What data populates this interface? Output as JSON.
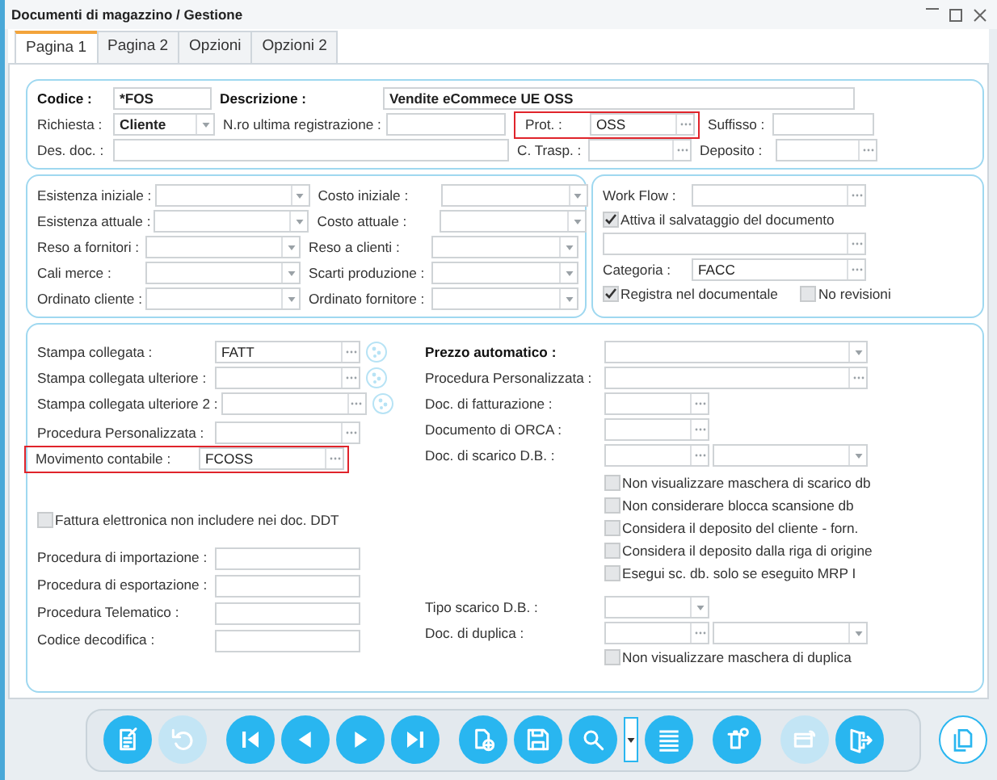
{
  "window": {
    "title": "Documenti di magazzino / Gestione"
  },
  "tabs": [
    {
      "label": "Pagina 1",
      "selected": true
    },
    {
      "label": "Pagina 2",
      "selected": false
    },
    {
      "label": "Opzioni",
      "selected": false
    },
    {
      "label": "Opzioni 2",
      "selected": false
    }
  ],
  "header": {
    "codice": {
      "label": "Codice :",
      "value": "*FOS",
      "label_bold": true,
      "value_bold": true
    },
    "descrizione": {
      "label": "Descrizione :",
      "value": "Vendite eCommece UE OSS",
      "label_bold": true,
      "value_bold": true
    },
    "richiesta": {
      "label": "Richiesta :",
      "value": "Cliente",
      "value_bold": true
    },
    "nro_ultima_registrazione": {
      "label": "N.ro ultima registrazione :"
    },
    "prot": {
      "label": "Prot. :",
      "value": "OSS",
      "highlighted": true
    },
    "suffisso": {
      "label": "Suffisso :"
    },
    "des_doc": {
      "label": "Des. doc. :"
    },
    "c_trasp": {
      "label": "C. Trasp. :"
    },
    "deposito": {
      "label": "Deposito :"
    }
  },
  "stock": [
    {
      "label": "Esistenza iniziale :"
    },
    {
      "label": "Costo iniziale :"
    },
    {
      "label": "Esistenza attuale :"
    },
    {
      "label": "Costo attuale :"
    },
    {
      "label": "Reso a fornitori :"
    },
    {
      "label": "Reso a clienti :"
    },
    {
      "label": "Cali merce :"
    },
    {
      "label": "Scarti produzione :"
    },
    {
      "label": "Ordinato cliente :"
    },
    {
      "label": "Ordinato fornitore :"
    }
  ],
  "workflow": {
    "work_flow": {
      "label": "Work Flow :"
    },
    "attiva": {
      "label": "Attiva il salvataggio del documento",
      "checked": true
    },
    "categoria": {
      "label": "Categoria :",
      "value": "FACC"
    },
    "registra": {
      "label": "Registra nel documentale",
      "checked": true
    },
    "no_revisioni": {
      "label": "No revisioni",
      "checked": false
    }
  },
  "print": {
    "stampa_collegata": {
      "label": "Stampa collegata :",
      "value": "FATT"
    },
    "stampa_ulteriore": {
      "label": "Stampa collegata ulteriore :"
    },
    "stampa_ulteriore_2": {
      "label": "Stampa collegata ulteriore 2 :"
    },
    "procedura_personalizzata": {
      "label": "Procedura Personalizzata :"
    },
    "movimento_contabile": {
      "label": "Movimento contabile :",
      "value": "FCOSS",
      "highlighted": true
    },
    "fattura_elettronica": {
      "label": "Fattura elettronica non includere nei doc. DDT",
      "checked": false
    },
    "procedura_importazione": {
      "label": "Procedura di importazione :"
    },
    "procedura_esportazione": {
      "label": "Procedura di esportazione :"
    },
    "procedura_telematico": {
      "label": "Procedura Telematico :"
    },
    "codice_decodifica": {
      "label": "Codice decodifica :"
    }
  },
  "options": {
    "prezzo_automatico": {
      "label": "Prezzo automatico :",
      "label_bold": true
    },
    "procedura_personalizzata": {
      "label": "Procedura Personalizzata :"
    },
    "doc_fatturazione": {
      "label": "Doc. di fatturazione :"
    },
    "documento_orca": {
      "label": "Documento di ORCA :"
    },
    "doc_scarico": {
      "label": "Doc. di scarico D.B. :"
    },
    "scarico_checks": [
      {
        "label": "Non visualizzare maschera di scarico db",
        "checked": false
      },
      {
        "label": "Non considerare blocca scansione db",
        "checked": false
      },
      {
        "label": "Considera il deposito del cliente - forn.",
        "checked": false
      },
      {
        "label": "Considera il deposito dalla riga di origine",
        "checked": false
      },
      {
        "label": "Esegui sc. db. solo se eseguito MRP I",
        "checked": false
      }
    ],
    "tipo_scarico": {
      "label": "Tipo scarico D.B. :"
    },
    "doc_duplica": {
      "label": "Doc. di duplica :"
    },
    "non_visualizzare_duplica": {
      "label": "Non visualizzare maschera di duplica",
      "checked": false
    }
  },
  "toolbar": [
    {
      "kind": "edit",
      "disabled": false
    },
    {
      "kind": "undo",
      "disabled": true
    },
    {
      "kind": "first",
      "disabled": false
    },
    {
      "kind": "previous",
      "disabled": false
    },
    {
      "kind": "next",
      "disabled": false
    },
    {
      "kind": "last",
      "disabled": false
    },
    {
      "kind": "new",
      "disabled": false
    },
    {
      "kind": "save",
      "disabled": false
    },
    {
      "kind": "search",
      "disabled": false
    },
    {
      "kind": "dropdown",
      "disabled": false
    },
    {
      "kind": "list",
      "disabled": false
    },
    {
      "kind": "delete",
      "disabled": false
    },
    {
      "kind": "window",
      "disabled": true
    },
    {
      "kind": "exit",
      "disabled": false
    }
  ],
  "side_button": {
    "kind": "copy",
    "disabled": false
  }
}
